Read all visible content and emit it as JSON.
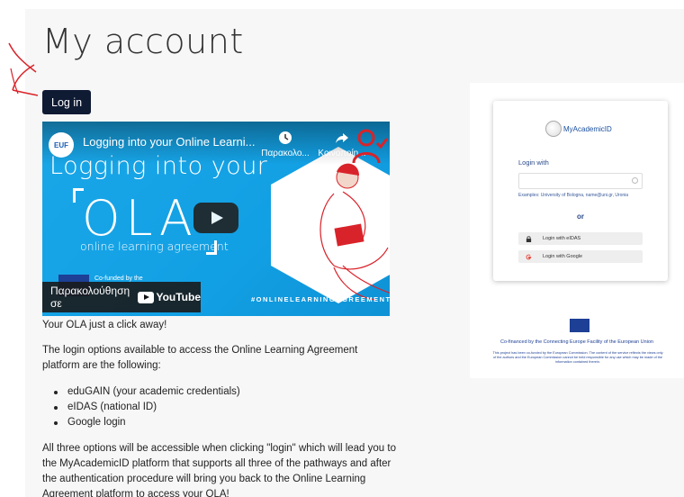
{
  "page": {
    "title": "My account",
    "login_button": "Log in"
  },
  "video": {
    "channel_badge": "EUF",
    "title": "Logging into your Online Learni...",
    "watch_later_label": "Παρακολο...",
    "share_label": "Κοινοποίη...",
    "slide_heading": "Logging into your",
    "slide_ola": "OLA",
    "slide_subtitle": "online learning agreement",
    "cofunded_text": "Co-funded by the",
    "hashtag": "#ONLINELEARNINGAGREEMENT",
    "watch_on_label": "Παρακολούθηση σε",
    "youtube_label": "YouTube"
  },
  "content": {
    "intro": "Your OLA just a click away!",
    "options_intro": "The login options available to access the Online Learning Agreement platform are the following:",
    "options": [
      "eduGAIN (your academic credentials)",
      "eIDAS (national ID)",
      "Google login"
    ],
    "outro": "All three options will be accessible when clicking \"login\" which will lead you to the MyAcademicID platform that supports all three of the pathways and after the authentication procedure will bring you back to the Online Learning Agreement platform to access your OLA!"
  },
  "login_card": {
    "logo_text": "MyAcademicID",
    "login_with": "Login with",
    "examples": "Examples: University of Bologna, name@uni.gr, Uronia",
    "or": "or",
    "eidas_label": "Login with eIDAS",
    "google_label": "Login with Google"
  },
  "footer": {
    "cofinanced": "Co-financed by the Connecting Europe Facility of the European Union",
    "disclaimer": "This project has been co-funded by the European Commission. The content of the service reflects the views only of the authors and the European Commission cannot be held responsible for any use which may be made of the information contained therein."
  },
  "colors": {
    "button_bg": "#0f1a33",
    "video_bg": "#1aa7e8",
    "eu_blue": "#1d3f95",
    "annotation_red": "#d9232a"
  }
}
